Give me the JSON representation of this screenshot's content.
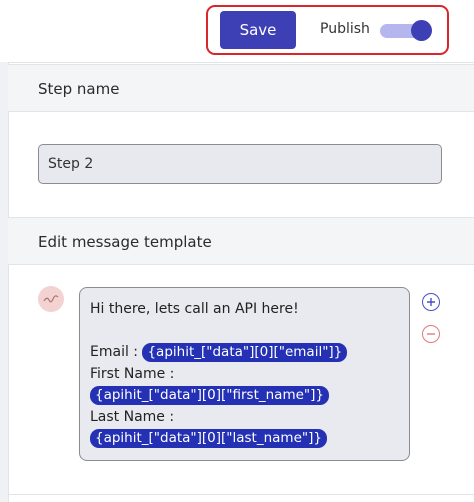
{
  "toolbar": {
    "save_label": "Save",
    "publish_label": "Publish",
    "publish_enabled": true
  },
  "step_name": {
    "heading": "Step name",
    "value": "Step 2"
  },
  "message_template": {
    "heading": "Edit message template",
    "intro": "Hi there, lets call an API here!",
    "email_label": "Email :",
    "email_token": "{apihit_[\"data\"][0][\"email\"]}",
    "first_name_label": "First Name :",
    "first_name_token": "{apihit_[\"data\"][0][\"first_name\"]}",
    "last_name_label": "Last Name :",
    "last_name_token": "{apihit_[\"data\"][0][\"last_name\"]}"
  },
  "icons": {
    "avatar": "avatar-icon",
    "add": "plus-circle-icon",
    "remove": "minus-circle-icon"
  },
  "colors": {
    "accent": "#3d3fb5",
    "highlight": "#d8262a",
    "token": "#2431b5"
  }
}
